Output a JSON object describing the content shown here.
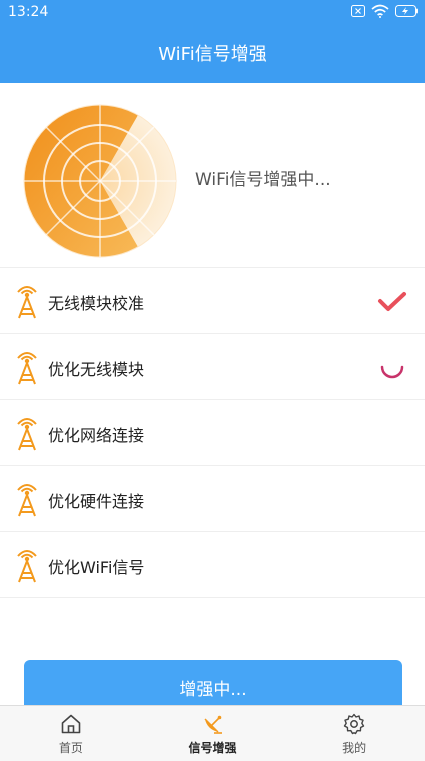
{
  "status_bar": {
    "time": "13:24",
    "icons": [
      "close-box-icon",
      "wifi-icon",
      "battery-charging-icon"
    ]
  },
  "header": {
    "title": "WiFi信号增强"
  },
  "radar": {
    "status_text": "WiFi信号增强中..."
  },
  "tasks": [
    {
      "label": "无线模块校准",
      "icon": "signal-tower-icon",
      "status": "done"
    },
    {
      "label": "优化无线模块",
      "icon": "signal-tower-icon",
      "status": "loading"
    },
    {
      "label": "优化网络连接",
      "icon": "signal-tower-icon",
      "status": "pending"
    },
    {
      "label": "优化硬件连接",
      "icon": "signal-tower-icon",
      "status": "pending"
    },
    {
      "label": "优化WiFi信号",
      "icon": "signal-tower-icon",
      "status": "pending"
    }
  ],
  "boost_button": {
    "label": "增强中..."
  },
  "tabbar": {
    "items": [
      {
        "label": "首页",
        "icon": "home-icon",
        "active": false
      },
      {
        "label": "信号增强",
        "icon": "satellite-dish-icon",
        "active": true
      },
      {
        "label": "我的",
        "icon": "gear-icon",
        "active": false
      }
    ]
  },
  "colors": {
    "primary": "#3d9df2",
    "accent_orange": "#f39a1e",
    "check_red": "#e8505b",
    "loading_pink": "#c8336a"
  }
}
